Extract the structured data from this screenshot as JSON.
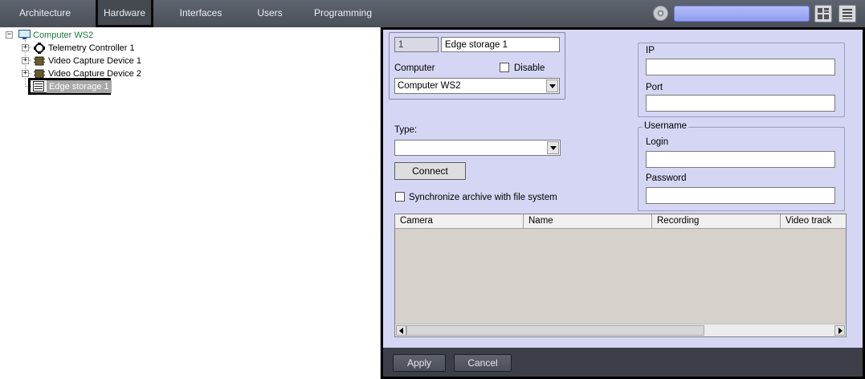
{
  "top_tabs": [
    {
      "label": "Architecture"
    },
    {
      "label": "Hardware",
      "active": true
    },
    {
      "label": "Interfaces"
    },
    {
      "label": "Users"
    },
    {
      "label": "Programming"
    }
  ],
  "top_right": {
    "search_value": "",
    "icons": [
      "gear-icon",
      "layout-grid-icon",
      "menu-list-icon"
    ]
  },
  "tree": {
    "root": {
      "label": "Computer WS2",
      "icon": "monitor-icon",
      "color": "#1a7a3a"
    },
    "children": [
      {
        "label": "Telemetry Controller 1",
        "icon": "telemetry-icon"
      },
      {
        "label": "Video Capture Device 1",
        "icon": "chip-icon"
      },
      {
        "label": "Video Capture Device 2",
        "icon": "chip-icon"
      },
      {
        "label": "Edge storage 1",
        "icon": "storage-icon",
        "selected": true
      }
    ]
  },
  "form": {
    "id_value": "1",
    "name_value": "Edge storage 1",
    "computer_label": "Computer",
    "disable_label": "Disable",
    "computer_value": "Computer WS2",
    "type_label": "Type:",
    "type_value": "",
    "connect_label": "Connect",
    "sync_label": "Synchronize archive with file system",
    "ip_label": "IP",
    "ip_value": "",
    "port_label": "Port",
    "port_value": "",
    "username_group": "Username",
    "login_label": "Login",
    "login_value": "",
    "password_label": "Password",
    "password_value": ""
  },
  "table": {
    "columns": [
      "Camera",
      "Name",
      "Recording",
      "Video track"
    ],
    "rows": []
  },
  "footer": {
    "apply_label": "Apply",
    "cancel_label": "Cancel"
  },
  "colors": {
    "topbar": "#4f545d",
    "panel_bg": "#d4d6f4",
    "search_field": "#98a6f2",
    "tree_root_text": "#1a7a3a",
    "selection_bg": "#a7a7a7"
  }
}
